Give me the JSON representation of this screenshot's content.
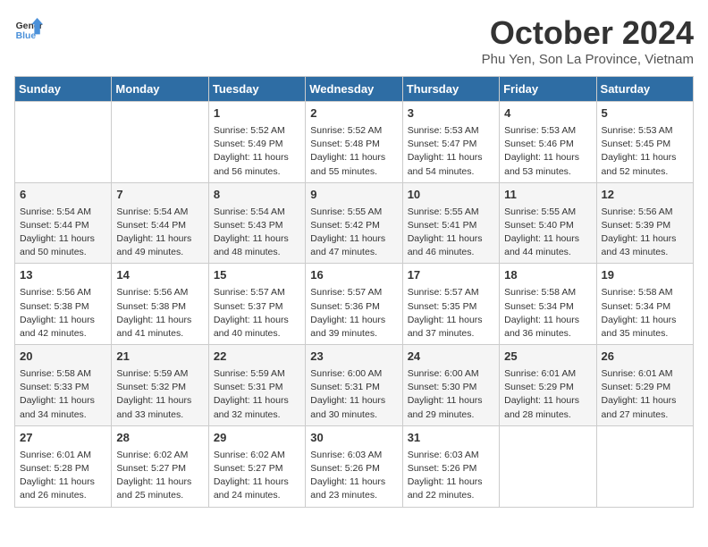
{
  "logo": {
    "line1": "General",
    "line2": "Blue"
  },
  "title": "October 2024",
  "location": "Phu Yen, Son La Province, Vietnam",
  "weekdays": [
    "Sunday",
    "Monday",
    "Tuesday",
    "Wednesday",
    "Thursday",
    "Friday",
    "Saturday"
  ],
  "weeks": [
    [
      {
        "day": "",
        "empty": true
      },
      {
        "day": "",
        "empty": true
      },
      {
        "day": "1",
        "sunrise": "Sunrise: 5:52 AM",
        "sunset": "Sunset: 5:49 PM",
        "daylight": "Daylight: 11 hours and 56 minutes."
      },
      {
        "day": "2",
        "sunrise": "Sunrise: 5:52 AM",
        "sunset": "Sunset: 5:48 PM",
        "daylight": "Daylight: 11 hours and 55 minutes."
      },
      {
        "day": "3",
        "sunrise": "Sunrise: 5:53 AM",
        "sunset": "Sunset: 5:47 PM",
        "daylight": "Daylight: 11 hours and 54 minutes."
      },
      {
        "day": "4",
        "sunrise": "Sunrise: 5:53 AM",
        "sunset": "Sunset: 5:46 PM",
        "daylight": "Daylight: 11 hours and 53 minutes."
      },
      {
        "day": "5",
        "sunrise": "Sunrise: 5:53 AM",
        "sunset": "Sunset: 5:45 PM",
        "daylight": "Daylight: 11 hours and 52 minutes."
      }
    ],
    [
      {
        "day": "6",
        "sunrise": "Sunrise: 5:54 AM",
        "sunset": "Sunset: 5:44 PM",
        "daylight": "Daylight: 11 hours and 50 minutes."
      },
      {
        "day": "7",
        "sunrise": "Sunrise: 5:54 AM",
        "sunset": "Sunset: 5:44 PM",
        "daylight": "Daylight: 11 hours and 49 minutes."
      },
      {
        "day": "8",
        "sunrise": "Sunrise: 5:54 AM",
        "sunset": "Sunset: 5:43 PM",
        "daylight": "Daylight: 11 hours and 48 minutes."
      },
      {
        "day": "9",
        "sunrise": "Sunrise: 5:55 AM",
        "sunset": "Sunset: 5:42 PM",
        "daylight": "Daylight: 11 hours and 47 minutes."
      },
      {
        "day": "10",
        "sunrise": "Sunrise: 5:55 AM",
        "sunset": "Sunset: 5:41 PM",
        "daylight": "Daylight: 11 hours and 46 minutes."
      },
      {
        "day": "11",
        "sunrise": "Sunrise: 5:55 AM",
        "sunset": "Sunset: 5:40 PM",
        "daylight": "Daylight: 11 hours and 44 minutes."
      },
      {
        "day": "12",
        "sunrise": "Sunrise: 5:56 AM",
        "sunset": "Sunset: 5:39 PM",
        "daylight": "Daylight: 11 hours and 43 minutes."
      }
    ],
    [
      {
        "day": "13",
        "sunrise": "Sunrise: 5:56 AM",
        "sunset": "Sunset: 5:38 PM",
        "daylight": "Daylight: 11 hours and 42 minutes."
      },
      {
        "day": "14",
        "sunrise": "Sunrise: 5:56 AM",
        "sunset": "Sunset: 5:38 PM",
        "daylight": "Daylight: 11 hours and 41 minutes."
      },
      {
        "day": "15",
        "sunrise": "Sunrise: 5:57 AM",
        "sunset": "Sunset: 5:37 PM",
        "daylight": "Daylight: 11 hours and 40 minutes."
      },
      {
        "day": "16",
        "sunrise": "Sunrise: 5:57 AM",
        "sunset": "Sunset: 5:36 PM",
        "daylight": "Daylight: 11 hours and 39 minutes."
      },
      {
        "day": "17",
        "sunrise": "Sunrise: 5:57 AM",
        "sunset": "Sunset: 5:35 PM",
        "daylight": "Daylight: 11 hours and 37 minutes."
      },
      {
        "day": "18",
        "sunrise": "Sunrise: 5:58 AM",
        "sunset": "Sunset: 5:34 PM",
        "daylight": "Daylight: 11 hours and 36 minutes."
      },
      {
        "day": "19",
        "sunrise": "Sunrise: 5:58 AM",
        "sunset": "Sunset: 5:34 PM",
        "daylight": "Daylight: 11 hours and 35 minutes."
      }
    ],
    [
      {
        "day": "20",
        "sunrise": "Sunrise: 5:58 AM",
        "sunset": "Sunset: 5:33 PM",
        "daylight": "Daylight: 11 hours and 34 minutes."
      },
      {
        "day": "21",
        "sunrise": "Sunrise: 5:59 AM",
        "sunset": "Sunset: 5:32 PM",
        "daylight": "Daylight: 11 hours and 33 minutes."
      },
      {
        "day": "22",
        "sunrise": "Sunrise: 5:59 AM",
        "sunset": "Sunset: 5:31 PM",
        "daylight": "Daylight: 11 hours and 32 minutes."
      },
      {
        "day": "23",
        "sunrise": "Sunrise: 6:00 AM",
        "sunset": "Sunset: 5:31 PM",
        "daylight": "Daylight: 11 hours and 30 minutes."
      },
      {
        "day": "24",
        "sunrise": "Sunrise: 6:00 AM",
        "sunset": "Sunset: 5:30 PM",
        "daylight": "Daylight: 11 hours and 29 minutes."
      },
      {
        "day": "25",
        "sunrise": "Sunrise: 6:01 AM",
        "sunset": "Sunset: 5:29 PM",
        "daylight": "Daylight: 11 hours and 28 minutes."
      },
      {
        "day": "26",
        "sunrise": "Sunrise: 6:01 AM",
        "sunset": "Sunset: 5:29 PM",
        "daylight": "Daylight: 11 hours and 27 minutes."
      }
    ],
    [
      {
        "day": "27",
        "sunrise": "Sunrise: 6:01 AM",
        "sunset": "Sunset: 5:28 PM",
        "daylight": "Daylight: 11 hours and 26 minutes."
      },
      {
        "day": "28",
        "sunrise": "Sunrise: 6:02 AM",
        "sunset": "Sunset: 5:27 PM",
        "daylight": "Daylight: 11 hours and 25 minutes."
      },
      {
        "day": "29",
        "sunrise": "Sunrise: 6:02 AM",
        "sunset": "Sunset: 5:27 PM",
        "daylight": "Daylight: 11 hours and 24 minutes."
      },
      {
        "day": "30",
        "sunrise": "Sunrise: 6:03 AM",
        "sunset": "Sunset: 5:26 PM",
        "daylight": "Daylight: 11 hours and 23 minutes."
      },
      {
        "day": "31",
        "sunrise": "Sunrise: 6:03 AM",
        "sunset": "Sunset: 5:26 PM",
        "daylight": "Daylight: 11 hours and 22 minutes."
      },
      {
        "day": "",
        "empty": true
      },
      {
        "day": "",
        "empty": true
      }
    ]
  ]
}
